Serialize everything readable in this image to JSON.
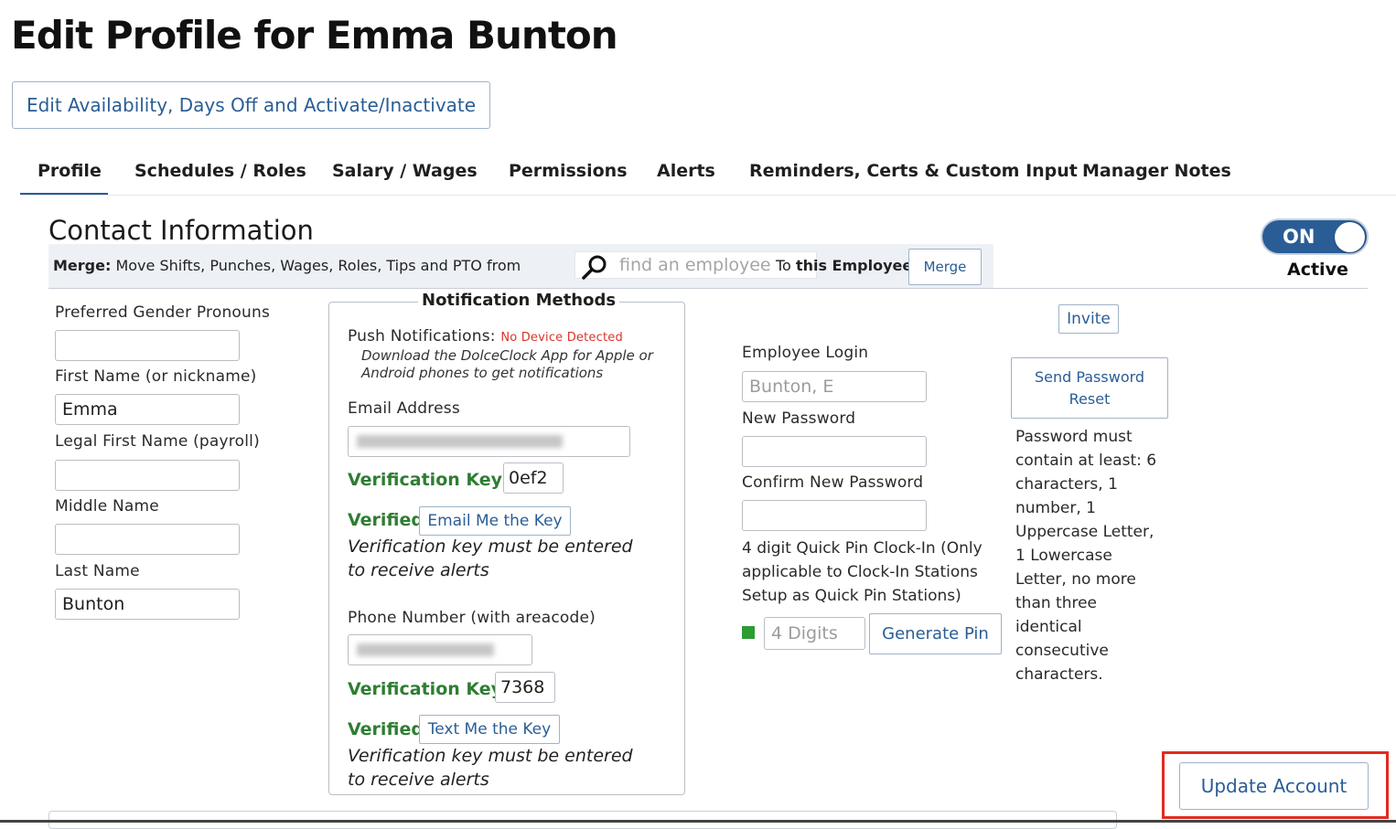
{
  "page": {
    "title": "Edit Profile for Emma Bunton",
    "availability_button": "Edit Availability, Days Off and Activate/Inactivate"
  },
  "tabs": [
    {
      "label": "Profile",
      "active": true
    },
    {
      "label": "Schedules / Roles"
    },
    {
      "label": "Salary / Wages"
    },
    {
      "label": "Permissions"
    },
    {
      "label": "Alerts"
    },
    {
      "label": "Reminders, Certs & Custom Input"
    },
    {
      "label": "Manager Notes"
    }
  ],
  "contact": {
    "section_title": "Contact Information",
    "merge": {
      "label_bold": "Merge:",
      "label_text": " Move Shifts, Punches, Wages, Roles, Tips and PTO from",
      "search_placeholder": "find an employee",
      "to_label_pre": "To ",
      "to_label_bold": "this Employee",
      "button": "Merge"
    },
    "status": {
      "toggle": "ON",
      "label": "Active"
    }
  },
  "names": {
    "pronouns_label": "Preferred Gender Pronouns",
    "pronouns_value": "",
    "first_name_label": "First Name (or nickname)",
    "first_name_value": "Emma",
    "legal_first_label": "Legal First Name (payroll)",
    "legal_first_value": "",
    "middle_name_label": "Middle Name",
    "middle_name_value": "",
    "last_name_label": "Last Name",
    "last_name_value": "Bunton"
  },
  "notifications": {
    "legend": "Notification Methods",
    "push_label": "Push Notifications:",
    "push_status": "No Device Detected",
    "push_hint_1": "Download the DolceClock App for Apple or",
    "push_hint_2": "Android phones to get notifications",
    "email_label": "Email Address",
    "email_key_label": "Verification Key",
    "email_key_value": "0ef2",
    "email_verified": "Verified",
    "email_button": "Email Me the Key",
    "email_note_1": "Verification key must be entered",
    "email_note_2": "to receive alerts",
    "phone_label": "Phone Number (with areacode)",
    "phone_key_label": "Verification Key",
    "phone_key_value": "7368",
    "phone_verified": "Verified",
    "phone_button": "Text Me the Key",
    "phone_note_1": "Verification key must be entered",
    "phone_note_2": "to receive alerts"
  },
  "login": {
    "invite_button": "Invite",
    "employee_login_label": "Employee Login",
    "employee_login_placeholder": "Bunton, E",
    "new_password_label": "New Password",
    "confirm_password_label": "Confirm New Password",
    "send_reset_button_1": "Send Password",
    "send_reset_button_2": "Reset",
    "password_rules": [
      "Password must",
      "contain at least: 6",
      "characters, 1",
      "number, 1",
      "Uppercase Letter,",
      "1 Lowercase",
      "Letter, no more",
      "than three",
      "identical",
      "consecutive",
      "characters."
    ],
    "pin_note": [
      "4 digit Quick Pin Clock-In (Only",
      "applicable to Clock-In Stations",
      "Setup as Quick Pin Stations)"
    ],
    "pin_placeholder": "4 Digits",
    "generate_pin_button": "Generate Pin"
  },
  "actions": {
    "update_button": "Update Account",
    "highlight_color": "#e02c1f"
  },
  "colors": {
    "accent": "#2a5d96",
    "verified": "#2e7d32",
    "warning": "#d9342b"
  }
}
